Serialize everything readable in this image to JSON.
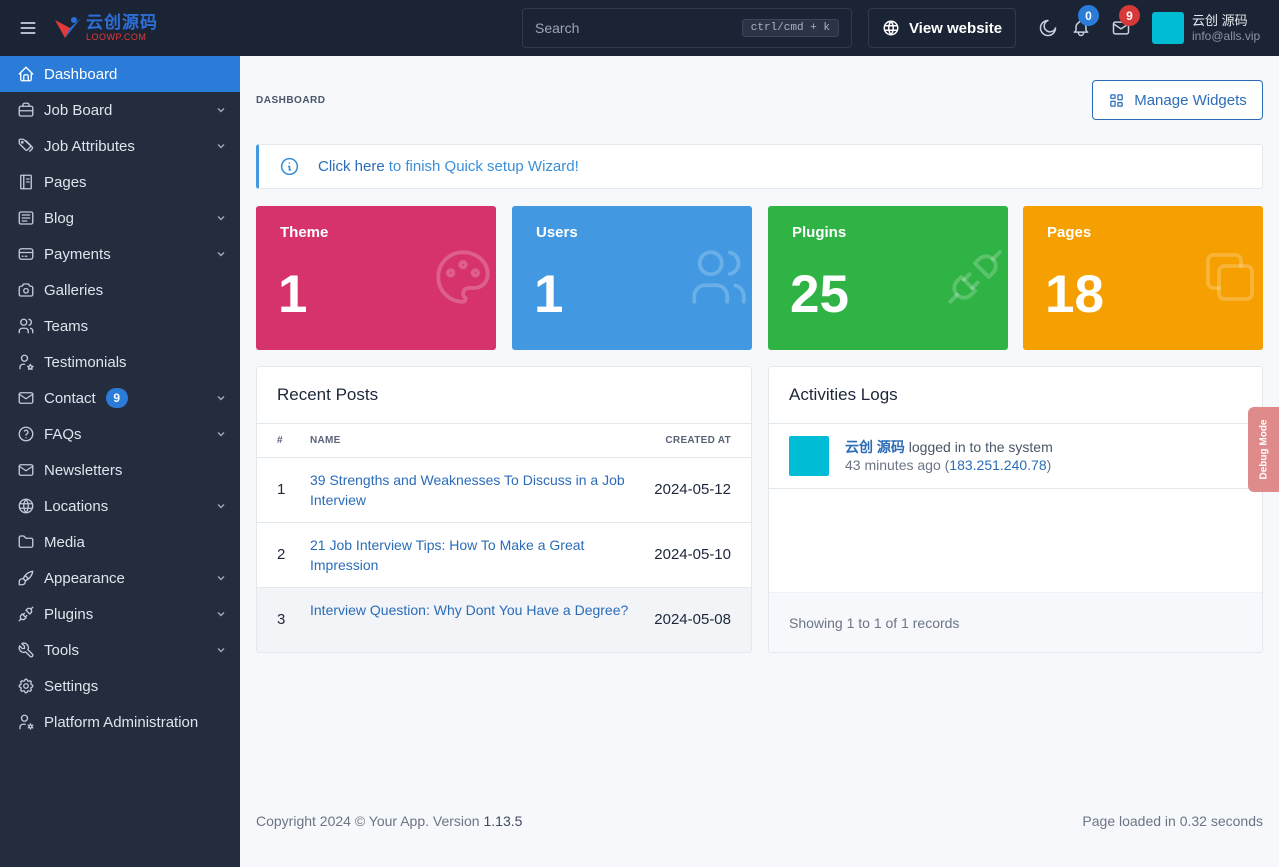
{
  "header": {
    "logo_cn": "云创源码",
    "logo_en": "LOOWP.COM",
    "search_placeholder": "Search",
    "search_shortcut": "ctrl/cmd + k",
    "view_website_label": "View website",
    "notifications_count": "0",
    "messages_count": "9",
    "user_name": "云创 源码",
    "user_email": "info@alls.vip",
    "avatar_color": "#00bcd4"
  },
  "sidebar": {
    "items": [
      {
        "label": "Dashboard",
        "icon": "home-icon",
        "active": true,
        "has_children": false
      },
      {
        "label": "Job Board",
        "icon": "briefcase-icon",
        "has_children": true
      },
      {
        "label": "Job Attributes",
        "icon": "tags-icon",
        "has_children": true
      },
      {
        "label": "Pages",
        "icon": "book-icon",
        "has_children": false
      },
      {
        "label": "Blog",
        "icon": "article-icon",
        "has_children": true
      },
      {
        "label": "Payments",
        "icon": "credit-card-icon",
        "has_children": true
      },
      {
        "label": "Galleries",
        "icon": "camera-icon",
        "has_children": false
      },
      {
        "label": "Teams",
        "icon": "users-icon",
        "has_children": false
      },
      {
        "label": "Testimonials",
        "icon": "user-star-icon",
        "has_children": false
      },
      {
        "label": "Contact",
        "icon": "mail-icon",
        "has_children": true,
        "badge": "9"
      },
      {
        "label": "FAQs",
        "icon": "help-circle-icon",
        "has_children": true
      },
      {
        "label": "Newsletters",
        "icon": "mail-icon",
        "has_children": false
      },
      {
        "label": "Locations",
        "icon": "globe-icon",
        "has_children": true
      },
      {
        "label": "Media",
        "icon": "folder-icon",
        "has_children": false
      },
      {
        "label": "Appearance",
        "icon": "brush-icon",
        "has_children": true
      },
      {
        "label": "Plugins",
        "icon": "plug-icon",
        "has_children": true
      },
      {
        "label": "Tools",
        "icon": "tool-icon",
        "has_children": true
      },
      {
        "label": "Settings",
        "icon": "settings-icon",
        "has_children": false
      },
      {
        "label": "Platform Administration",
        "icon": "user-cog-icon",
        "has_children": false
      }
    ]
  },
  "page": {
    "breadcrumb": "DASHBOARD",
    "manage_widgets_label": "Manage Widgets"
  },
  "alert": {
    "link_text": "Click here",
    "rest_text": "to finish Quick setup Wizard!"
  },
  "stats": [
    {
      "label": "Theme",
      "value": "1",
      "color": "#d6336c",
      "icon": "palette-icon"
    },
    {
      "label": "Users",
      "value": "1",
      "color": "#4299e1",
      "icon": "users-icon"
    },
    {
      "label": "Plugins",
      "value": "25",
      "color": "#2fb344",
      "icon": "plug-icon"
    },
    {
      "label": "Pages",
      "value": "18",
      "color": "#f59f00",
      "icon": "copy-icon"
    }
  ],
  "recent_posts": {
    "title": "Recent Posts",
    "columns": [
      "#",
      "NAME",
      "CREATED AT"
    ],
    "rows": [
      {
        "num": "1",
        "name": "39 Strengths and Weaknesses To Discuss in a Job Interview",
        "created_at": "2024-05-12"
      },
      {
        "num": "2",
        "name": "21 Job Interview Tips: How To Make a Great Impression",
        "created_at": "2024-05-10"
      },
      {
        "num": "3",
        "name": "Interview Question: Why Dont You Have a Degree?",
        "created_at": "2024-05-08"
      }
    ]
  },
  "activities": {
    "title": "Activities Logs",
    "entries": [
      {
        "user": "云创 源码",
        "action": "logged in to the system",
        "time": "43 minutes ago",
        "ip": "183.251.240.78"
      }
    ],
    "footer": "Showing 1 to 1 of 1 records"
  },
  "footer": {
    "copyright": "Copyright 2024 © Your App. Version",
    "version": "1.13.5",
    "page_loaded": "Page loaded in 0.32 seconds"
  },
  "debug_label": "Debug Mode"
}
